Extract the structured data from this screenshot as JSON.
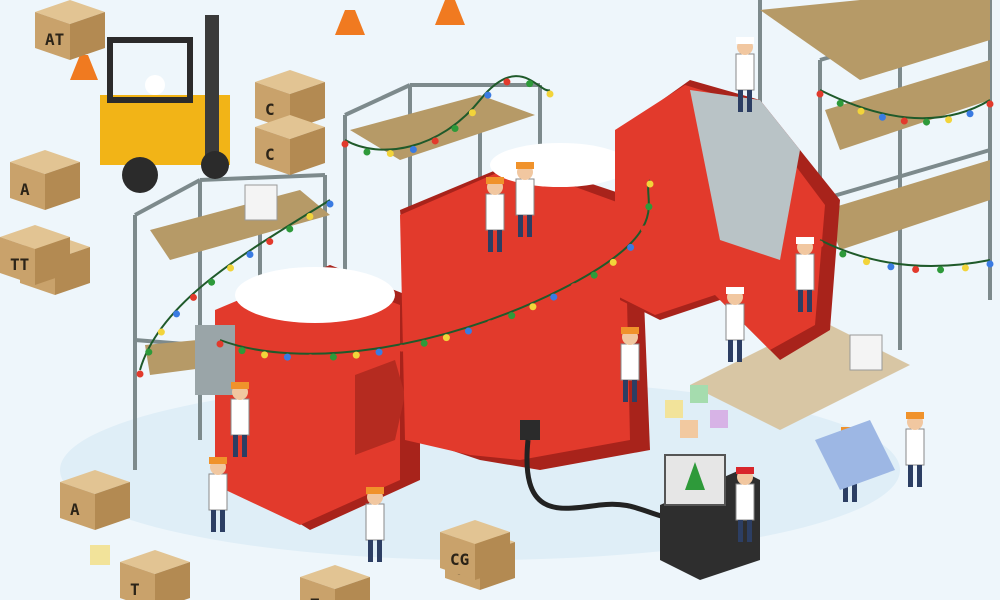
{
  "scene": {
    "banner_letters": [
      "D",
      "N",
      "A"
    ],
    "box_labels": {
      "box_a1": "A",
      "box_a2": "A",
      "box_t1": "T",
      "box_t2": "T",
      "box_c1": "C",
      "box_c2": "C",
      "box_g1": "G",
      "box_cg": "CG",
      "box_tt": "TT",
      "box_at_stack": "AT",
      "box_t_stack": "T"
    },
    "colors": {
      "snow": "#eef6fb",
      "letter_red": "#e23a2c",
      "letter_dark": "#a8231b",
      "scaffold": "#7d8a8c",
      "plank": "#b69a67",
      "cardboard": "#c9a26b",
      "lab_coat": "#ffffff",
      "hard_hat": "#f0922b",
      "santa_hat": "#d8262c",
      "tree": "#2e9a3a"
    }
  }
}
